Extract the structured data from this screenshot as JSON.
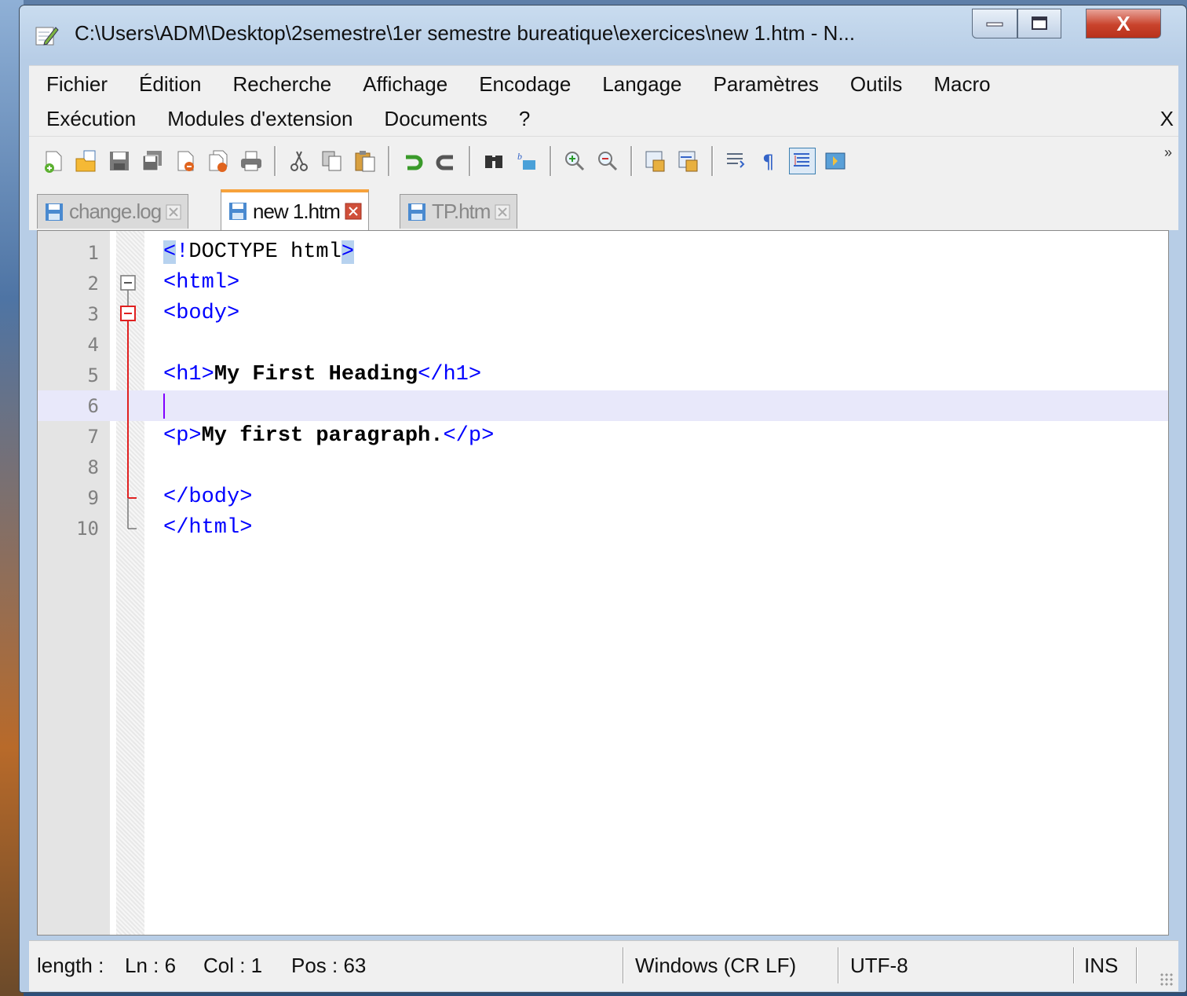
{
  "window": {
    "title": "C:\\Users\\ADM\\Desktop\\2semestre\\1er semestre bureatique\\exercices\\new 1.htm - N...",
    "buttons": {
      "minimize": "minimize-icon",
      "maximize": "maximize-icon",
      "close": "X"
    }
  },
  "menu": {
    "row1": [
      "Fichier",
      "Édition",
      "Recherche",
      "Affichage",
      "Encodage",
      "Langage",
      "Paramètres",
      "Outils",
      "Macro"
    ],
    "row2": [
      "Exécution",
      "Modules d'extension",
      "Documents",
      "?"
    ],
    "close_label": "X"
  },
  "toolbar": {
    "icons": [
      "new-file-icon",
      "open-file-icon",
      "save-icon",
      "save-all-icon",
      "close-icon",
      "close-all-icon",
      "print-icon",
      "cut-icon",
      "copy-icon",
      "paste-icon",
      "undo-icon",
      "redo-icon",
      "find-icon",
      "replace-icon",
      "zoom-in-icon",
      "zoom-out-icon",
      "sync-vertical-icon",
      "sync-horizontal-icon",
      "word-wrap-icon",
      "show-all-characters-icon",
      "indent-guide-icon",
      "user-language-icon"
    ],
    "more": "»"
  },
  "tabs": [
    {
      "label": "change.log",
      "active": false
    },
    {
      "label": "new 1.htm",
      "active": true
    },
    {
      "label": "TP.htm",
      "active": false
    }
  ],
  "editor": {
    "line_numbers": [
      "1",
      "2",
      "3",
      "4",
      "5",
      "6",
      "7",
      "8",
      "9",
      "10"
    ],
    "lines": {
      "l1_open": "<",
      "l1_bang": "!",
      "l1_doctype": "DOCTYPE html",
      "l1_close": ">",
      "l2": "<html>",
      "l3": "<body>",
      "l5_open": "<h1>",
      "l5_text": "My First Heading",
      "l5_close": "</h1>",
      "l7_open": "<p>",
      "l7_text": "My first paragraph.",
      "l7_close": "</p>",
      "l9": "</body>",
      "l10": "</html>"
    },
    "current_line": 6
  },
  "status": {
    "length": "length :",
    "ln": "Ln : 6",
    "col": "Col : 1",
    "pos": "Pos : 63",
    "eol": "Windows (CR LF)",
    "encoding": "UTF-8",
    "mode": "INS"
  }
}
